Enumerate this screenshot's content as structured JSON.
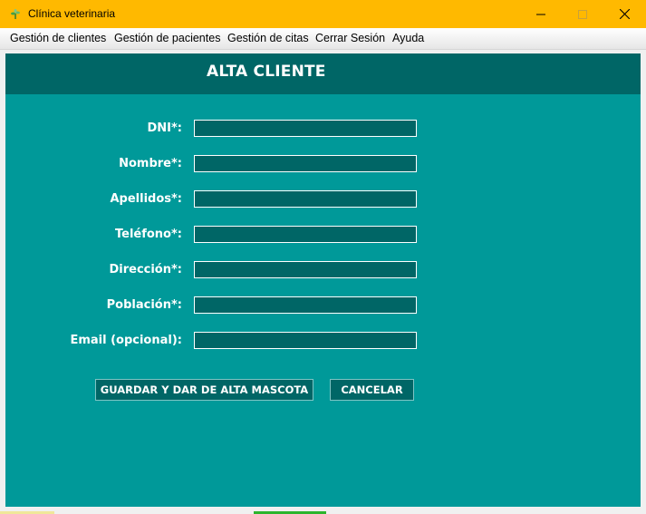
{
  "window": {
    "title": "Clínica veterinaria",
    "icon": "paw-leaf-icon",
    "accent_color": "#ffb900"
  },
  "menu": [
    {
      "label": "Gestión de clientes"
    },
    {
      "label": "Gestión de pacientes"
    },
    {
      "label": "Gestión de citas"
    },
    {
      "label": "Cerrar Sesión"
    },
    {
      "label": "Ayuda"
    }
  ],
  "form": {
    "title": "ALTA CLIENTE",
    "fields": [
      {
        "label": "DNI*:",
        "value": ""
      },
      {
        "label": "Nombre*:",
        "value": ""
      },
      {
        "label": "Apellidos*:",
        "value": ""
      },
      {
        "label": "Teléfono*:",
        "value": ""
      },
      {
        "label": "Dirección*:",
        "value": ""
      },
      {
        "label": "Población*:",
        "value": ""
      },
      {
        "label": "Email (opcional):",
        "value": ""
      }
    ],
    "buttons": {
      "save": "GUARDAR Y DAR DE ALTA MASCOTA",
      "cancel": "CANCELAR"
    },
    "colors": {
      "panel": "#009999",
      "header": "#006666",
      "input": "#006666"
    }
  }
}
